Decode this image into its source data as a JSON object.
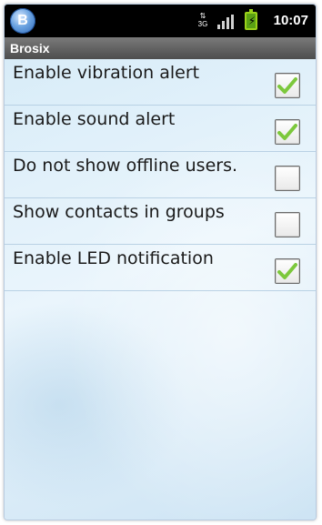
{
  "status_bar": {
    "app_icon": "brosix-app-icon",
    "app_icon_letter": "B",
    "network_type": "3G",
    "signal": "signal-bars-icon",
    "battery": "battery-charging-icon",
    "time": "10:07"
  },
  "title_bar": {
    "title": "Brosix"
  },
  "settings": [
    {
      "label": "Enable vibration alert",
      "checked": true
    },
    {
      "label": "Enable sound alert",
      "checked": true
    },
    {
      "label": "Do not show offline users.",
      "checked": false
    },
    {
      "label": "Show contacts in groups",
      "checked": false
    },
    {
      "label": "Enable LED notification",
      "checked": true
    }
  ],
  "colors": {
    "check": "#7cc83c",
    "title_bar": "#5c5c5c",
    "status_bar": "#000000"
  }
}
